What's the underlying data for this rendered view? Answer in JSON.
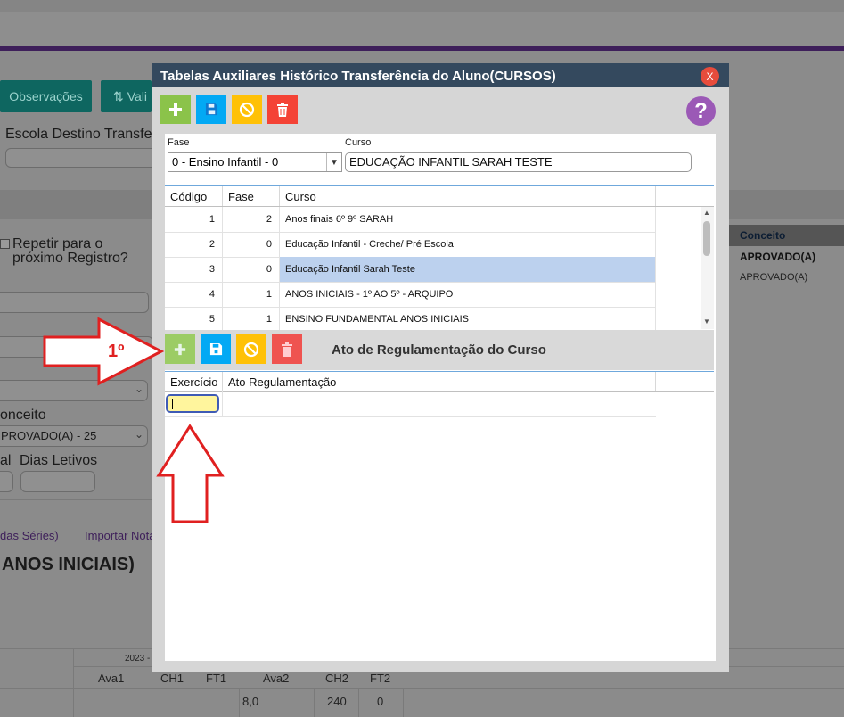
{
  "background": {
    "buttons": {
      "observacoes": "Observações",
      "vali": "Vali"
    },
    "escola_label": "Escola Destino Transfer",
    "repetir_label_1": "Repetir para o",
    "repetir_label_2": "próximo Registro?",
    "conceito_label": "onceito",
    "conceito_value": "PROVADO(A) - 25",
    "al_label": "al",
    "dias_letivos_label": "Dias Letivos",
    "links": {
      "series": "das Séries)",
      "importar": "Importar Nota"
    },
    "heading": "ANOS INICIAIS)",
    "right_panel": {
      "header": "Conceito",
      "value1": "APROVADO(A)",
      "value2": "APROVADO(A)"
    },
    "table": {
      "year": "2023 -",
      "cols": [
        "Ava1",
        "CH1",
        "FT1",
        "Ava2",
        "CH2",
        "FT2"
      ],
      "values": [
        "8,0",
        "240",
        "0"
      ]
    }
  },
  "modal": {
    "title": "Tabelas Auxiliares Histórico Transferência do Aluno(CURSOS)",
    "close": "X",
    "help": "?",
    "form": {
      "fase_label": "Fase",
      "fase_value": "0 - Ensino Infantil - 0",
      "curso_label": "Curso",
      "curso_value": "EDUCAÇÃO INFANTIL SARAH TESTE"
    },
    "grid": {
      "headers": [
        "Código",
        "Fase",
        "Curso"
      ],
      "rows": [
        {
          "codigo": "1",
          "fase": "2",
          "curso": "Anos finais 6º 9º SARAH"
        },
        {
          "codigo": "2",
          "fase": "0",
          "curso": "Educação Infantil - Creche/ Pré Escola"
        },
        {
          "codigo": "3",
          "fase": "0",
          "curso": "Educação Infantil Sarah Teste"
        },
        {
          "codigo": "4",
          "fase": "1",
          "curso": "ANOS INICIAIS - 1º AO 5º - ARQUIPO"
        },
        {
          "codigo": "5",
          "fase": "1",
          "curso": "ENSINO FUNDAMENTAL ANOS INICIAIS"
        }
      ]
    },
    "section_title": "Ato de Regulamentação do Curso",
    "sub_grid": {
      "headers": [
        "Exercício",
        "Ato Regulamentação"
      ]
    }
  },
  "annotation": {
    "label": "1º"
  },
  "colors": {
    "header": "#34495e",
    "green": "#8bc34a",
    "blue": "#03a9f4",
    "yellow": "#ffc107",
    "red": "#f44336",
    "annotation": "#e02020"
  }
}
